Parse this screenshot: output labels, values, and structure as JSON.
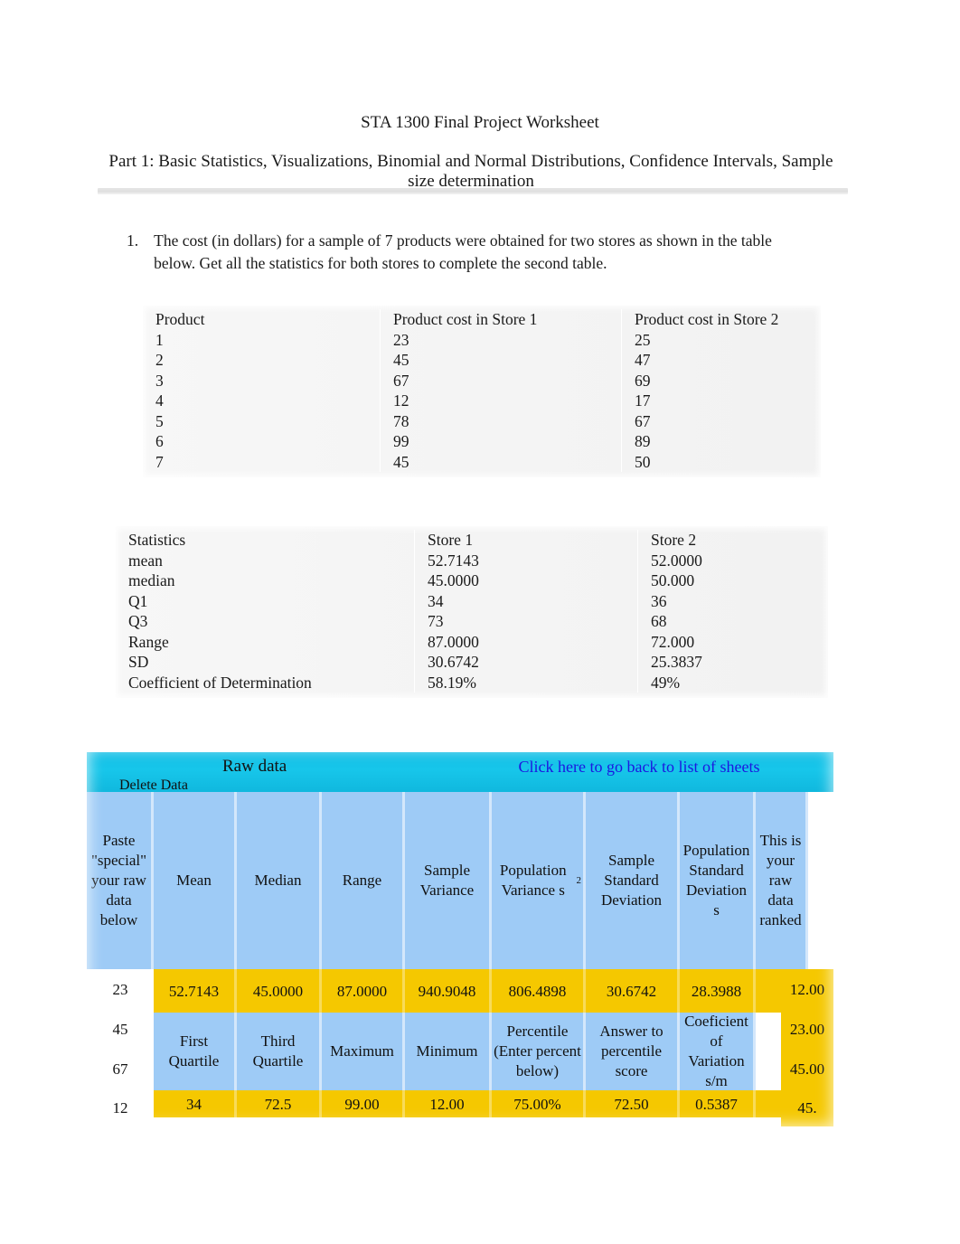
{
  "document": {
    "title": "STA 1300 Final Project Worksheet",
    "subtitle": "Part 1: Basic Statistics, Visualizations, Binomial and Normal Distributions, Confidence Intervals, Sample size determination"
  },
  "question": {
    "number": "1.",
    "text": "The cost (in dollars) for a sample of 7 products were obtained for two stores as shown in the table below. Get all the statistics for both stores to complete the second table."
  },
  "products_table": {
    "headers": [
      "Product",
      "Product cost in Store 1",
      "Product cost in Store 2"
    ],
    "rows": [
      [
        "1",
        "23",
        "25"
      ],
      [
        "2",
        "45",
        "47"
      ],
      [
        "3",
        "67",
        "69"
      ],
      [
        "4",
        "12",
        "17"
      ],
      [
        "5",
        "78",
        "67"
      ],
      [
        "6",
        "99",
        "89"
      ],
      [
        "7",
        "45",
        "50"
      ]
    ]
  },
  "statistics_table": {
    "headers": [
      "Statistics",
      "Store   1",
      "Store 2"
    ],
    "rows": [
      [
        "mean",
        "52.7143",
        "52.0000"
      ],
      [
        "median",
        "45.0000",
        "50.000"
      ],
      [
        "Q1",
        "34",
        "36"
      ],
      [
        "Q3",
        "73",
        "68"
      ],
      [
        "Range",
        "87.0000",
        "72.000"
      ],
      [
        "SD",
        "30.6742",
        "25.3837"
      ],
      [
        "Coefficient of Determination",
        "58.19%",
        "49%"
      ]
    ]
  },
  "spreadsheet": {
    "banner": {
      "raw_data_label": "Raw data",
      "back_link": "Click here to go back to list of sheets",
      "delete_button": "Delete Data"
    },
    "header_row_1": [
      "Paste \"special\" your raw data below",
      "Mean",
      "Median",
      "Range",
      "Sample Variance",
      "Population Variance s",
      "Sample Standard Deviation",
      "Population Standard Deviation s",
      "This is your raw data ranked"
    ],
    "population_variance_superscript": "2",
    "data_row_1": [
      "",
      "52.7143",
      "45.0000",
      "87.0000",
      "940.9048",
      "806.4898",
      "30.6742",
      "28.3988",
      ""
    ],
    "header_row_2": [
      "",
      "First Quartile",
      "Third Quartile",
      "Maximum",
      "Minimum",
      "Percentile (Enter percent below)",
      "Answer to percentile score",
      "Coeficient of Variation s/m",
      ""
    ],
    "data_row_2": [
      "",
      "34",
      "72.5",
      "99.00",
      "12.00",
      "75.00%",
      "72.50",
      "0.5387",
      ""
    ],
    "raw_data_column": [
      "23",
      "45",
      "67",
      "12"
    ],
    "ranked_column": [
      "12.00",
      "23.00",
      "45.00",
      "45."
    ],
    "colors": {
      "banner": "#16c3e8",
      "header_cell": "#9ecbf6",
      "data_cell": "#f5c800",
      "link": "#1b17e0"
    }
  }
}
